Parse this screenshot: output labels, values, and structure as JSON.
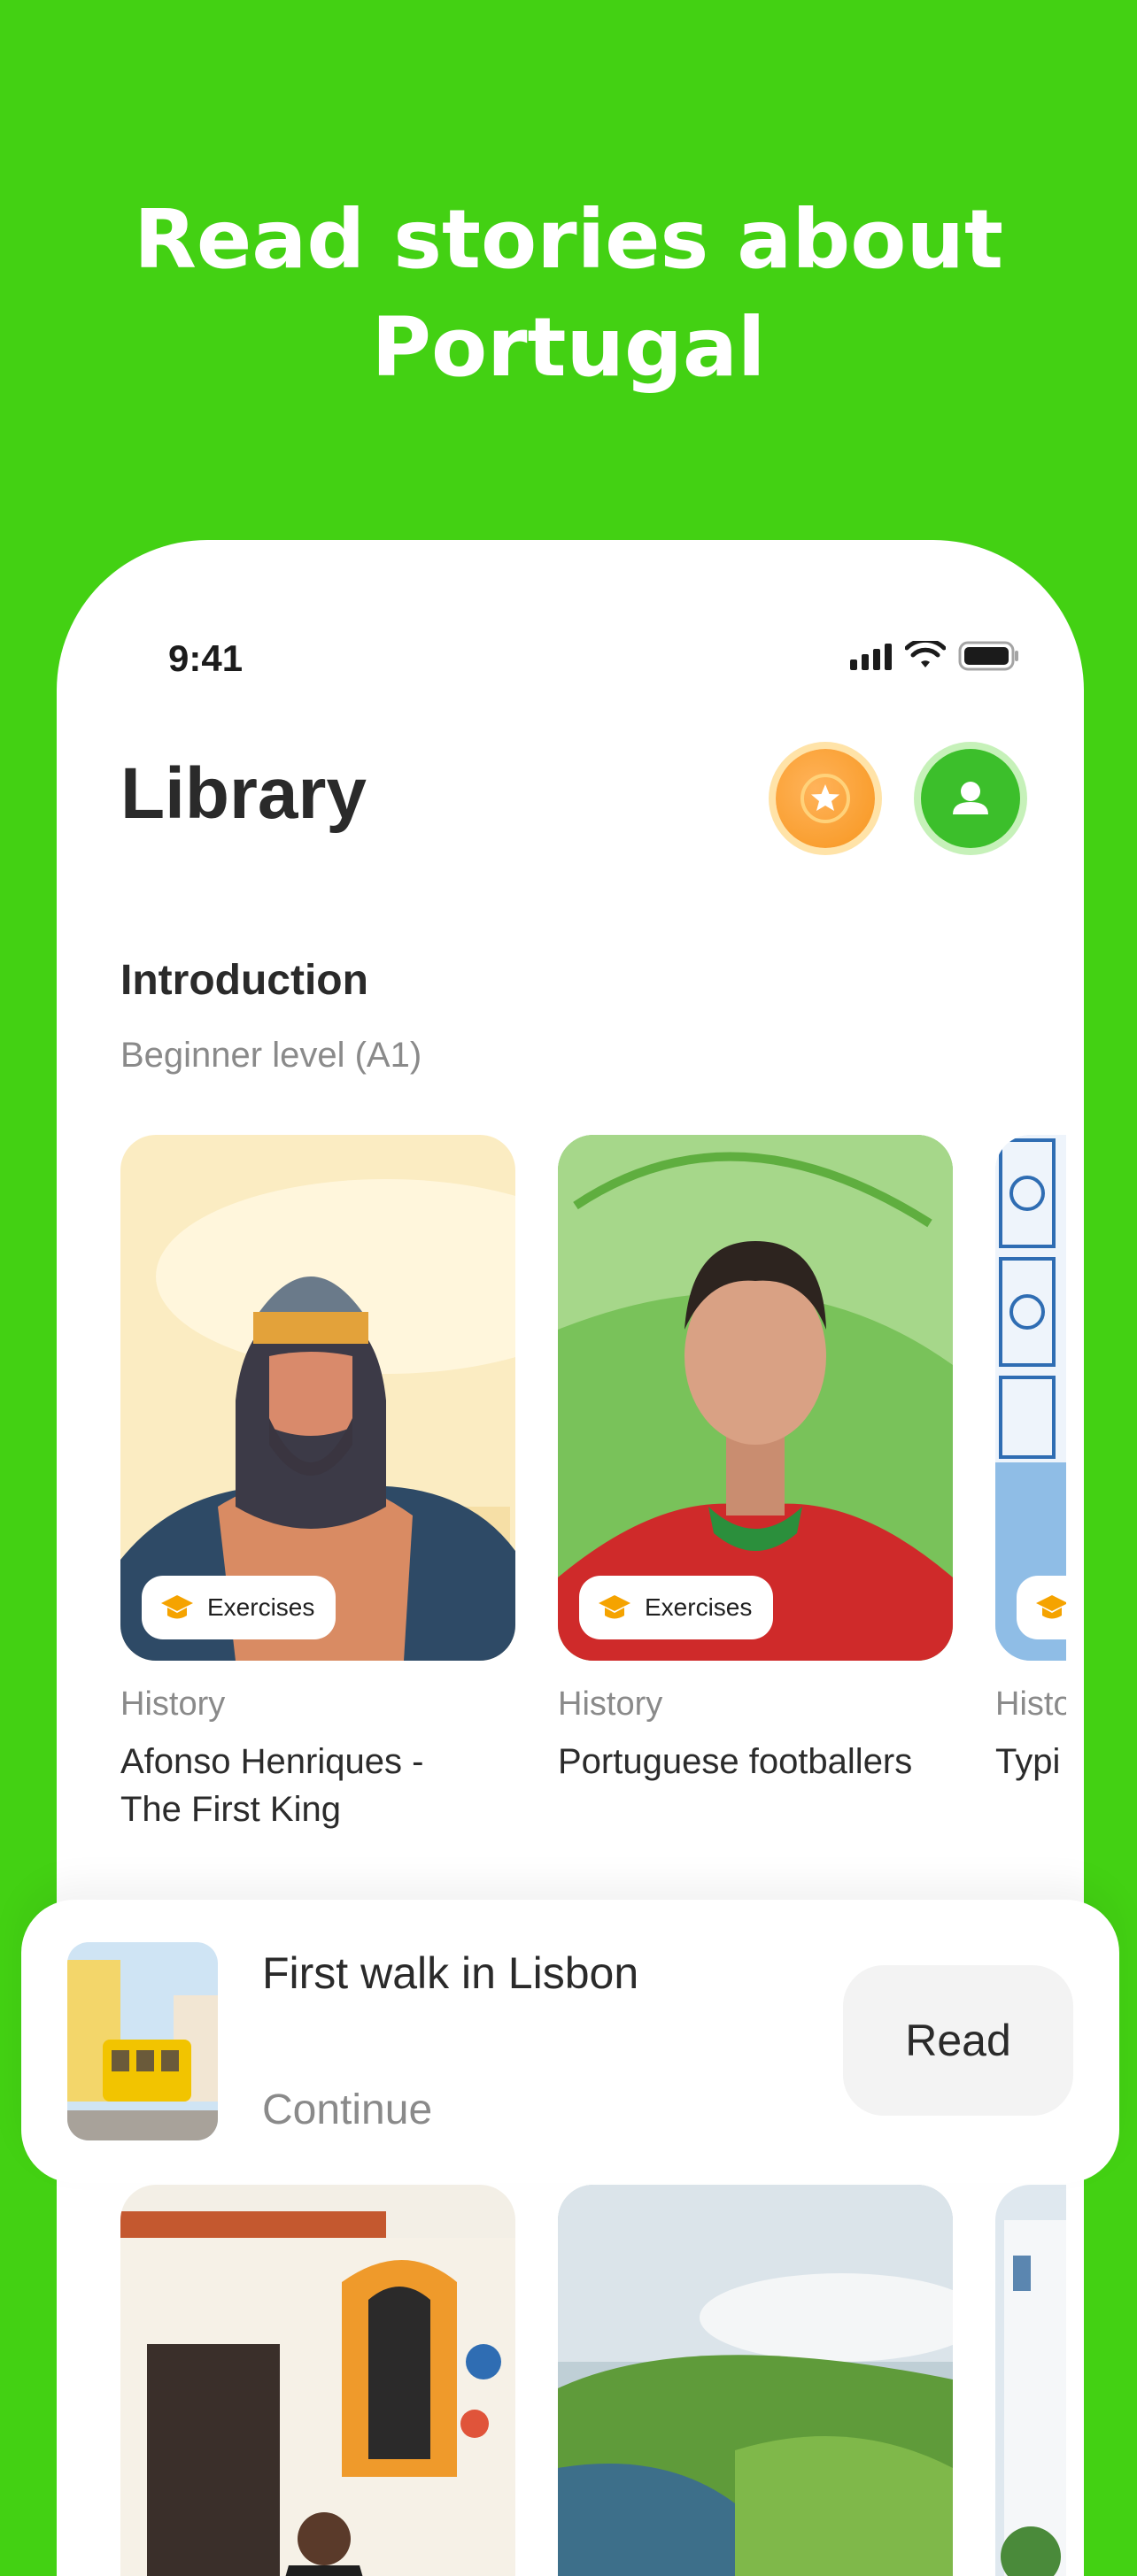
{
  "headline": {
    "line1": "Read stories about",
    "line2": "Portugal"
  },
  "status_bar": {
    "time": "9:41",
    "icons": [
      "cellular-signal-icon",
      "wifi-icon",
      "battery-icon"
    ]
  },
  "header": {
    "title": "Library",
    "buttons": [
      "streak-star-icon",
      "profile-icon"
    ]
  },
  "section": {
    "title": "Introduction",
    "subtitle": "Beginner level (A1)"
  },
  "stories": [
    {
      "category": "History",
      "title": "Afonso Henriques - The First King",
      "badge": "Exercises"
    },
    {
      "category": "History",
      "title": "Portuguese footballers",
      "badge": "Exercises"
    },
    {
      "category": "Histo",
      "title": "Typi",
      "badge": ""
    }
  ],
  "continue_reading": {
    "title": "First walk in Lisbon",
    "subtitle": "Continue",
    "button": "Read"
  },
  "colors": {
    "background": "#43d113",
    "accent_orange": "#f7961e",
    "accent_green": "#3cbf2b"
  }
}
